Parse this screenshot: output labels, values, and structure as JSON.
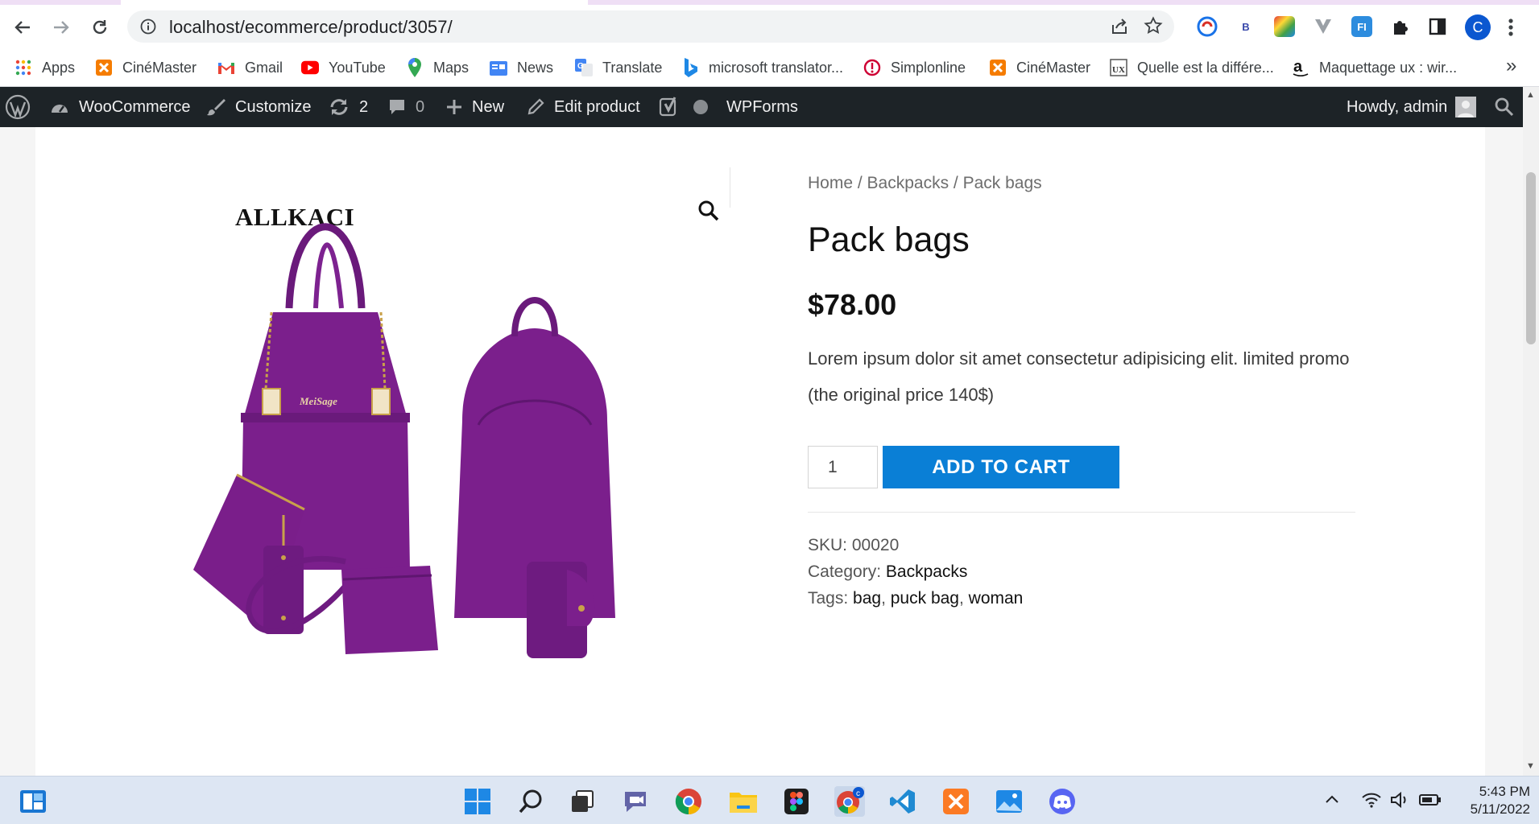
{
  "browser": {
    "url": "localhost/ecommerce/product/3057/",
    "profile_initial": "C",
    "extensions": [
      "ext-swirl-icon",
      "ext-b-icon",
      "ext-colorful-icon",
      "ext-v-icon",
      "ext-fi-icon",
      "puzzle-icon",
      "sidepanel-icon"
    ],
    "ext_b_label": "B",
    "ext_fi_label": "FI"
  },
  "bookmarks": [
    {
      "label": "Apps",
      "icon": "apps-grid-icon"
    },
    {
      "label": "CinéMaster",
      "icon": "cinemaster-icon"
    },
    {
      "label": "Gmail",
      "icon": "gmail-icon"
    },
    {
      "label": "YouTube",
      "icon": "youtube-icon"
    },
    {
      "label": "Maps",
      "icon": "maps-icon"
    },
    {
      "label": "News",
      "icon": "news-icon"
    },
    {
      "label": "Translate",
      "icon": "translate-icon"
    },
    {
      "label": "microsoft translator...",
      "icon": "bing-icon"
    },
    {
      "label": "Simplonline",
      "icon": "simplonline-icon"
    },
    {
      "label": "CinéMaster",
      "icon": "cinemaster-icon"
    },
    {
      "label": "Quelle est la différe...",
      "icon": "ux-blog-icon"
    },
    {
      "label": "Maquettage ux : wir...",
      "icon": "amazon-icon"
    }
  ],
  "adminbar": {
    "woocommerce": "WooCommerce",
    "customize": "Customize",
    "updates_count": "2",
    "comments_count": "0",
    "new": "New",
    "edit_product": "Edit product",
    "wpforms": "WPForms",
    "howdy": "Howdy, admin"
  },
  "product": {
    "brand_text": "ALLKACI",
    "breadcrumb": {
      "home": "Home",
      "sep": " / ",
      "category": "Backpacks",
      "current": "Pack bags"
    },
    "title": "Pack bags",
    "price": "$78.00",
    "description": "Lorem ipsum dolor sit amet consectetur adipisicing elit. limited promo (the original price 140$)",
    "quantity": "1",
    "add_to_cart": "ADD TO CART",
    "sku_label": "SKU: ",
    "sku": "00020",
    "category_label": "Category: ",
    "category": "Backpacks",
    "tags_label": "Tags: ",
    "tags": [
      "bag",
      "puck bag",
      "woman"
    ],
    "tag_sep": ", "
  },
  "colors": {
    "accent_button": "#0a7fd6",
    "adminbar_bg": "#1d2327",
    "bag_purple": "#7b1f8c"
  },
  "taskbar": {
    "apps": [
      "windows-start-icon",
      "search-icon",
      "task-view-icon",
      "teams-chat-icon",
      "chrome-icon",
      "file-explorer-icon",
      "figma-icon",
      "chrome-profile-icon",
      "vscode-icon",
      "xampp-icon",
      "photos-icon",
      "discord-icon"
    ],
    "time": "5:43 PM",
    "date": "5/11/2022"
  }
}
